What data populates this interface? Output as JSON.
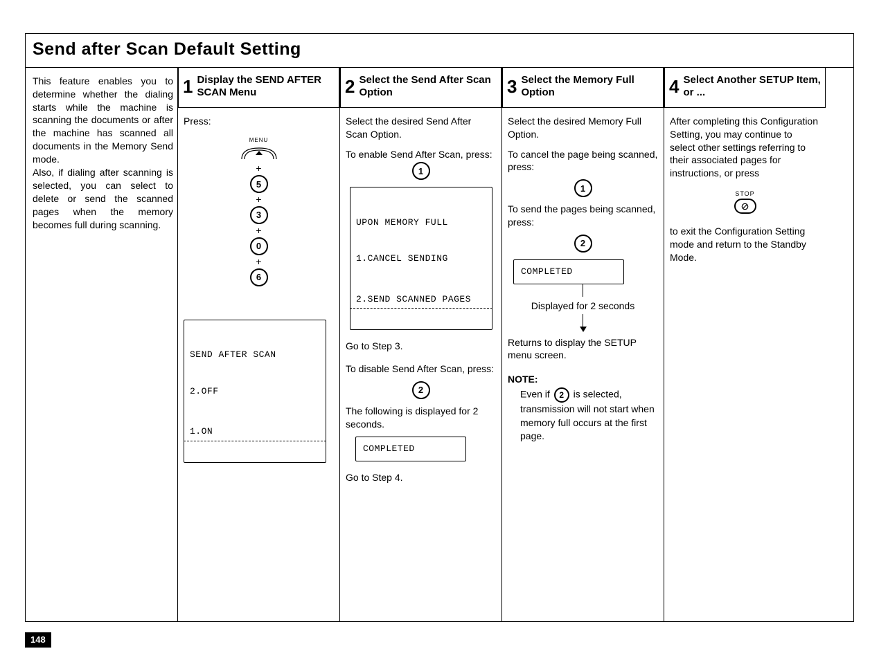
{
  "page_number": "148",
  "title": "Send after Scan Default Setting",
  "intro": {
    "p1": "This feature enables you to determine whether the dialing starts while the machine is scanning the documents or after the machine has scanned all documents in the Memory Send mode.",
    "p2": "Also, if dialing after scanning is selected, you can select to delete or send the scanned pages when the memory becomes full during scanning."
  },
  "steps": [
    {
      "num": "1",
      "title": "Display the SEND AFTER SCAN Menu",
      "press": "Press:",
      "menu_label": "MENU",
      "keys": [
        "5",
        "3",
        "0",
        "6"
      ],
      "lcd_line1": "SEND AFTER SCAN",
      "lcd_line2": "2.OFF",
      "lcd_alt": "1.ON"
    },
    {
      "num": "2",
      "title": "Select the Send After Scan Option",
      "intro": "Select the desired Send After Scan Option.",
      "enable_text": "To enable Send After Scan, press:",
      "key_enable": "1",
      "lcd_line1": "UPON MEMORY FULL",
      "lcd_line2": "1.CANCEL SENDING",
      "lcd_alt": "2.SEND SCANNED PAGES",
      "goto3": "Go to Step 3.",
      "disable_text": "To disable Send After Scan, press:",
      "key_disable": "2",
      "disp2s_text": "The following is displayed for 2 seconds.",
      "completed": "COMPLETED",
      "goto4": "Go to Step 4."
    },
    {
      "num": "3",
      "title": "Select the Memory Full Option",
      "intro": "Select the desired Memory Full Option.",
      "cancel_text": "To cancel the page being scanned, press:",
      "key_cancel": "1",
      "send_text": "To send the pages being scanned, press:",
      "key_send": "2",
      "completed": "COMPLETED",
      "disp2s": "Displayed for 2 seconds",
      "returns": "Returns to display the SETUP menu screen.",
      "note_head": "NOTE:",
      "note_a": "Even if ",
      "note_key": "2",
      "note_b": " is selected, transmission will not start when memory full occurs at the first page."
    },
    {
      "num": "4",
      "title": "Select Another SETUP Item, or ...",
      "intro": "After completing this Configuration Setting, you may continue to select other settings referring to their associated pages for instructions, or press",
      "stop_label": "STOP",
      "exit_text": "to exit the Configuration Setting mode and return to the Standby Mode."
    }
  ]
}
